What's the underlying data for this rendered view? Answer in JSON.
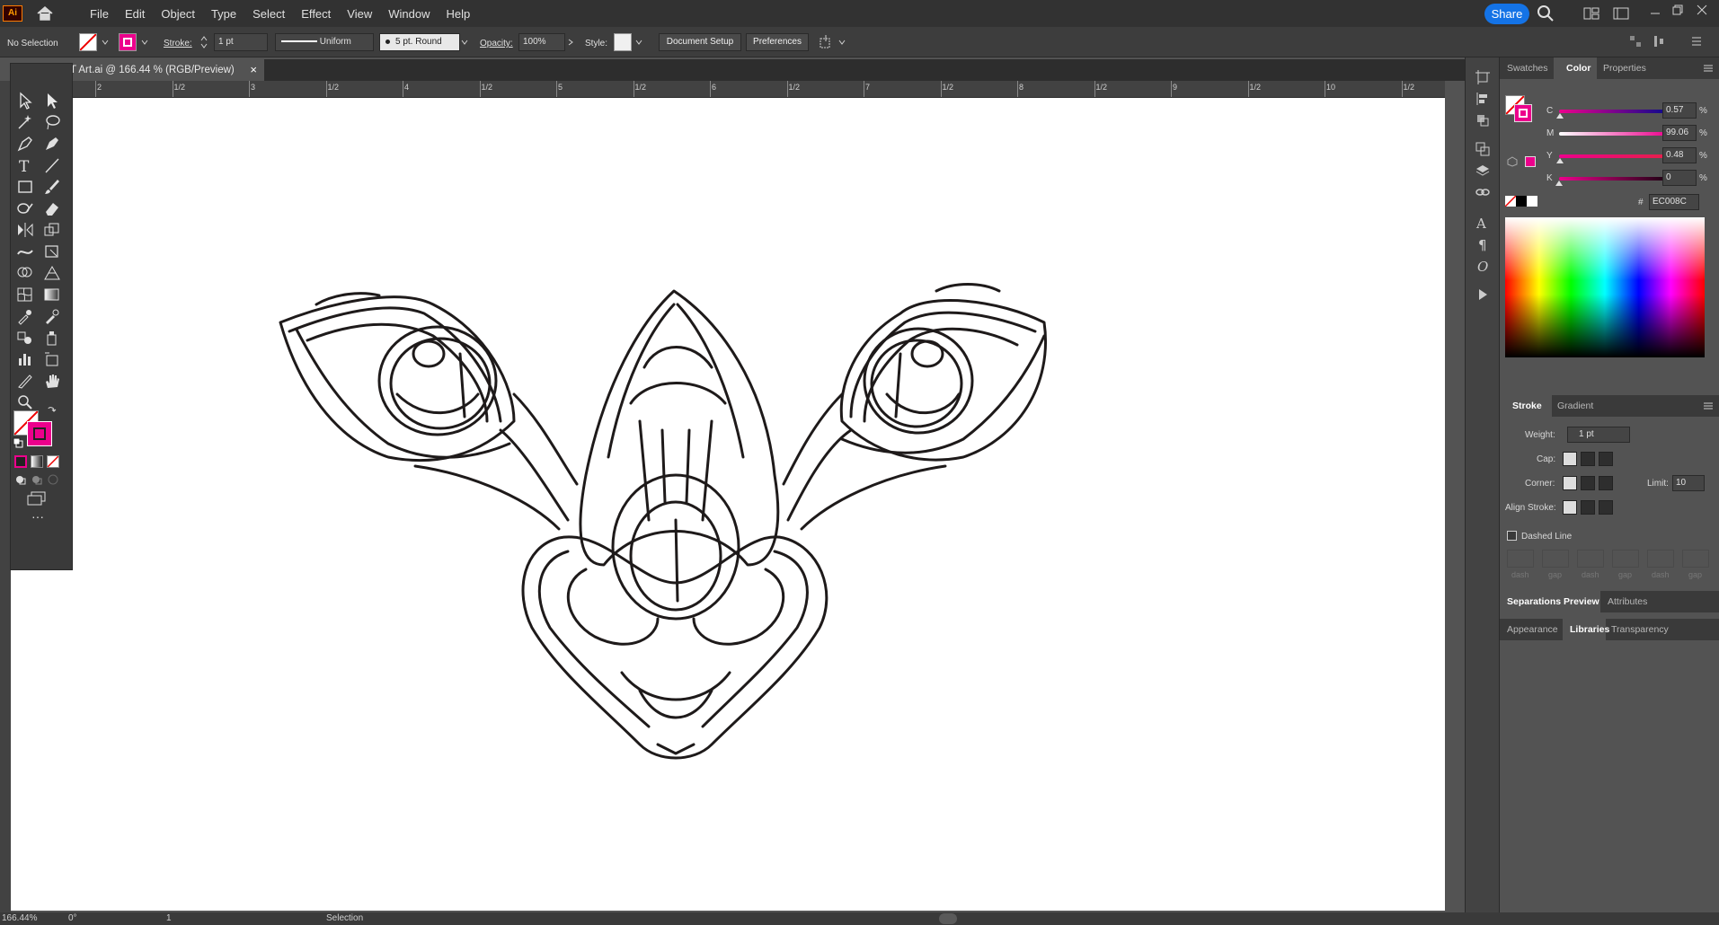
{
  "app": {
    "logo": "Ai",
    "share_label": "Share"
  },
  "menu": [
    "File",
    "Edit",
    "Object",
    "Type",
    "Select",
    "Effect",
    "View",
    "Window",
    "Help"
  ],
  "control": {
    "selection_label": "No Selection",
    "stroke_label": "Stroke:",
    "stroke_value": "1 pt",
    "profile_label": "Uniform",
    "brush_label": "5 pt. Round",
    "opacity_label": "Opacity:",
    "opacity_value": "100%",
    "style_label": "Style:",
    "doc_setup_label": "Document Setup",
    "preferences_label": "Preferences"
  },
  "document": {
    "tab_title": "T Art.ai @ 166.44 % (RGB/Preview)"
  },
  "ruler": {
    "labels": [
      "2",
      "1/2",
      "3",
      "1/2",
      "4",
      "1/2",
      "5",
      "1/2",
      "6",
      "1/2",
      "7",
      "1/2",
      "8",
      "1/2",
      "9",
      "1/2",
      "10",
      "1/2"
    ]
  },
  "color_panel": {
    "tabs": [
      "Swatches",
      "Color",
      "Properties"
    ],
    "active_tab": "Color",
    "channels": [
      {
        "label": "C",
        "value": "0.57",
        "level": 0.0057
      },
      {
        "label": "M",
        "value": "99.06",
        "level": 0.9906
      },
      {
        "label": "Y",
        "value": "0.48",
        "level": 0.0048
      },
      {
        "label": "K",
        "value": "0",
        "level": 0
      }
    ],
    "unit": "%",
    "hex_label": "#",
    "hex_value": "EC008C",
    "fill_color": "#EC008C"
  },
  "stroke_panel": {
    "tabs": [
      "Stroke",
      "Gradient"
    ],
    "active_tab": "Stroke",
    "weight_label": "Weight:",
    "weight_value": "1 pt",
    "cap_label": "Cap:",
    "corner_label": "Corner:",
    "limit_label": "Limit:",
    "limit_value": "10",
    "align_label": "Align Stroke:",
    "dashed_label": "Dashed Line",
    "dash_labels": [
      "dash",
      "gap",
      "dash",
      "gap",
      "dash",
      "gap"
    ]
  },
  "sep_panel": {
    "tabs": [
      "Separations Preview",
      "Attributes"
    ],
    "active_tab": "Separations Preview"
  },
  "lib_panel": {
    "tabs": [
      "Appearance",
      "Libraries",
      "Transparency"
    ],
    "active_tab": "Libraries"
  },
  "status": {
    "zoom": "166.44%",
    "rotation": "0°",
    "artboard": "1",
    "tool": "Selection"
  },
  "accent_color": "#EC008C"
}
